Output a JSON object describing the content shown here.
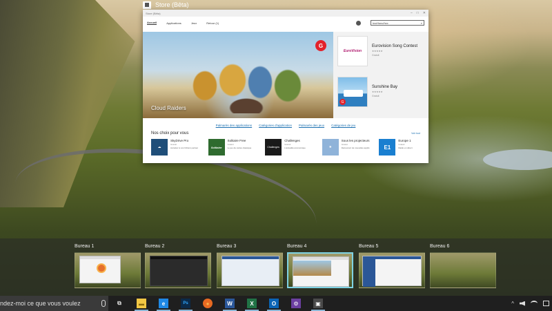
{
  "window_caption": "Store (Bêta)",
  "store": {
    "titlebar_text": "Store (Bêta)",
    "window_controls": [
      "–",
      "□",
      "✕"
    ],
    "nav": [
      "Accueil",
      "Applications",
      "Jeux",
      "Retour (1)"
    ],
    "search_value": "kvcHunc/hvc",
    "hero": {
      "title": "Cloud Raiders",
      "badge": "G"
    },
    "featured": [
      {
        "name": "Eurovision Song Contest",
        "thumb_text": "EuroVision",
        "meta_line1": "★★★★★",
        "meta_line2": "Gratuit"
      },
      {
        "name": "Sunshine Bay",
        "thumb_text": "",
        "meta_line1": "★★★★★",
        "meta_line2": "Gratuit"
      }
    ],
    "links": [
      "Palmarès des applications",
      "Catégories d'application",
      "Palmarès des jeux",
      "Catégories de jeu"
    ],
    "picks_title": "Nos choix pour vous",
    "see_all": "Voir tout",
    "picks": [
      {
        "name": "SkyDrive Pro",
        "sub": "Gratuit",
        "desc": "Accédez à vos fichiers partout",
        "icon_text": "☁",
        "color": "#1f4e79"
      },
      {
        "name": "Solitaire Free",
        "sub": "Gratuit",
        "desc": "Le jeu de cartes classique",
        "icon_text": "Solitaire",
        "color": "#2f6b2f"
      },
      {
        "name": "Challenges",
        "sub": "Gratuit",
        "desc": "L'actualité économique",
        "icon_text": "Challenges",
        "color": "#1a1a1a"
      },
      {
        "name": "Sous les projecteurs",
        "sub": "Gratuit",
        "desc": "Découvrez de nouvelles applis",
        "icon_text": "★",
        "color": "#8fb3d9"
      },
      {
        "name": "Europe 1",
        "sub": "Gratuit",
        "desc": "Radio en direct",
        "icon_text": "E1",
        "color": "#1a7fd0"
      }
    ]
  },
  "desktops": [
    {
      "label": "Bureau 1"
    },
    {
      "label": "Bureau 2"
    },
    {
      "label": "Bureau 3"
    },
    {
      "label": "Bureau 4"
    },
    {
      "label": "Bureau 5"
    },
    {
      "label": "Bureau 6"
    }
  ],
  "taskbar": {
    "search_text": "ndez-moi ce que vous voulez",
    "apps": [
      {
        "name": "task-view-icon",
        "glyph": "⧉",
        "color": "#1f1f1f"
      },
      {
        "name": "file-explorer-icon",
        "glyph": "▬",
        "color": "#f2c744"
      },
      {
        "name": "edge-browser-icon",
        "glyph": "e",
        "color": "#1e88e5"
      },
      {
        "name": "photoshop-icon",
        "glyph": "Ps",
        "color": "#0b2a4a"
      },
      {
        "name": "firefox-icon",
        "glyph": "●",
        "color": "#e86a22"
      },
      {
        "name": "word-icon",
        "glyph": "W",
        "color": "#2b579a"
      },
      {
        "name": "excel-icon",
        "glyph": "X",
        "color": "#217346"
      },
      {
        "name": "outlook-icon",
        "glyph": "O",
        "color": "#0a64b5"
      },
      {
        "name": "settings-icon",
        "glyph": "⚙",
        "color": "#6b3fa0"
      },
      {
        "name": "store-icon",
        "glyph": "▣",
        "color": "#4a4a4a"
      }
    ],
    "tray_arrow": "^"
  }
}
